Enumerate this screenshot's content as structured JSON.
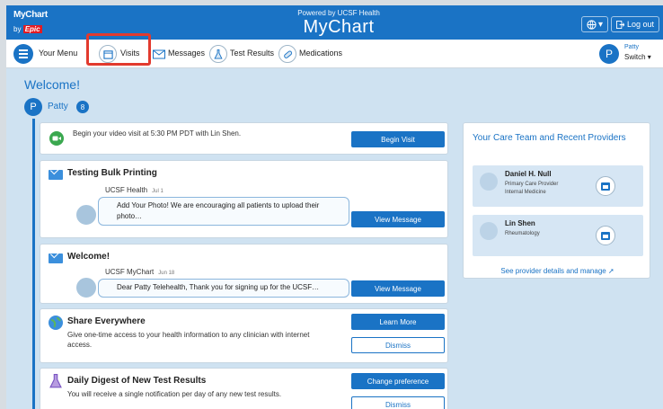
{
  "header": {
    "logo_line1": "MyChart",
    "logo_line2": "by",
    "logo_line3": "Epic",
    "powered_by": "Powered by UCSF Health",
    "brand": "MyChart",
    "logout_label": "Log out"
  },
  "nav": {
    "menu_label": "Your Menu",
    "items": [
      {
        "label": "Visits",
        "icon": "calendar-icon"
      },
      {
        "label": "Messages",
        "icon": "envelope-icon"
      },
      {
        "label": "Test Results",
        "icon": "flask-icon"
      },
      {
        "label": "Medications",
        "icon": "pill-icon"
      }
    ],
    "user_name": "Patty",
    "switch_label": "Switch",
    "user_initial": "P",
    "highlight_color": "#e23a2e"
  },
  "welcome": {
    "title": "Welcome!",
    "initial": "P",
    "name": "Patty",
    "badge": "8"
  },
  "cards": {
    "video": {
      "text": "Begin your video visit at 5:30 PM PDT with Lin Shen.",
      "button": "Begin Visit"
    },
    "bulk": {
      "title": "Testing Bulk Printing",
      "from": "UCSF Health",
      "date": "Jul 1",
      "message": "Add Your Photo! We are encouraging all patients to upload their photo…",
      "button": "View Message"
    },
    "welcome_msg": {
      "title": "Welcome!",
      "from": "UCSF MyChart",
      "date": "Jun 18",
      "message": "Dear Patty Telehealth, Thank you for signing up for the UCSF…",
      "button": "View Message"
    },
    "share": {
      "title": "Share Everywhere",
      "text": "Give one-time access to your health information to any clinician with internet access.",
      "button": "Learn More",
      "dismiss": "Dismiss"
    },
    "digest": {
      "title": "Daily Digest of New Test Results",
      "text": "You will receive a single notification per day of any new test results.",
      "button": "Change preference",
      "dismiss": "Dismiss"
    }
  },
  "care_team": {
    "title": "Your Care Team and Recent Providers",
    "providers": [
      {
        "name": "Daniel H. Null",
        "role": "Primary Care Provider",
        "dept": "Internal Medicine"
      },
      {
        "name": "Lin Shen",
        "role": "Rheumatology",
        "dept": ""
      }
    ],
    "link": "See provider details and manage"
  },
  "colors": {
    "brand_blue": "#1a73c5",
    "background": "#cfe2f1",
    "logo_red": "#e31b23"
  }
}
